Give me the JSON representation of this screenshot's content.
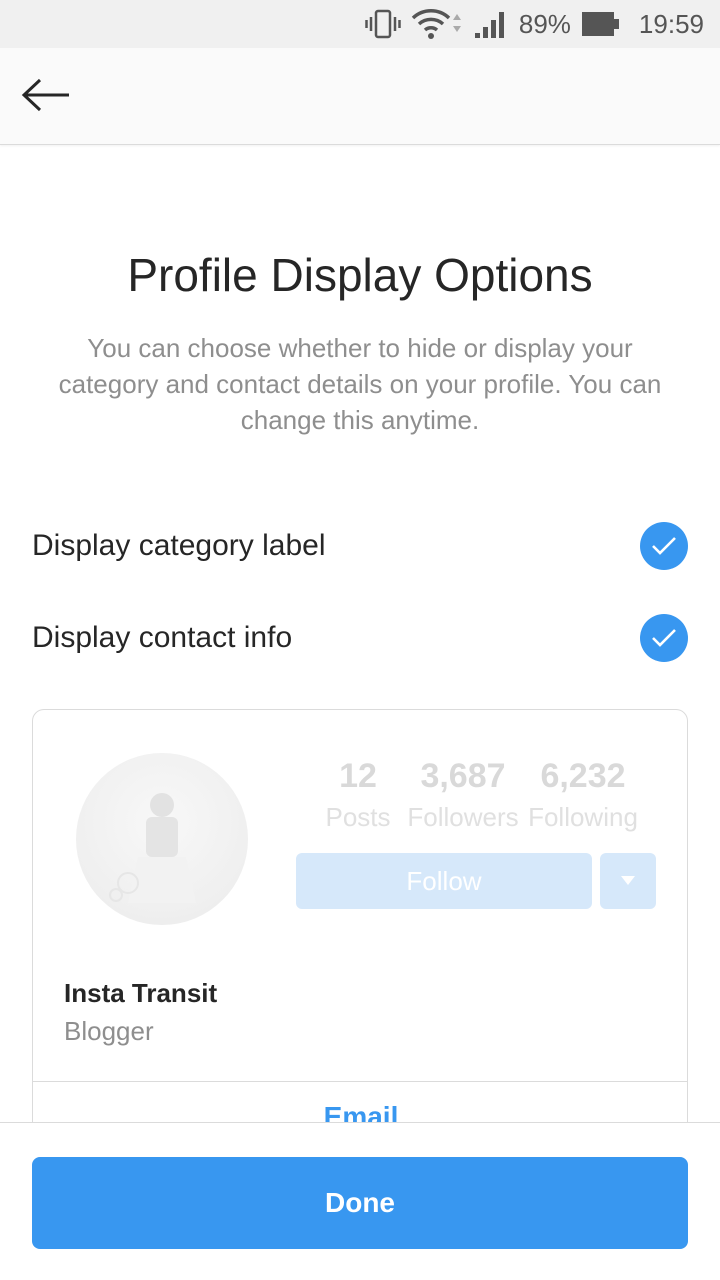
{
  "status_bar": {
    "battery": "89%",
    "time": "19:59",
    "icons": [
      "vibrate-icon",
      "wifi-icon",
      "signal-icon",
      "battery-icon"
    ]
  },
  "app_bar": {
    "back_icon": "arrow-left-icon"
  },
  "header": {
    "title": "Profile Display Options",
    "subtitle": "You can choose whether to hide or display your category and contact details on your profile. You can change this anytime."
  },
  "options": [
    {
      "label": "Display category label",
      "checked": true
    },
    {
      "label": "Display contact info",
      "checked": true
    }
  ],
  "preview": {
    "stats": [
      {
        "value": "12",
        "label": "Posts"
      },
      {
        "value": "3,687",
        "label": "Followers"
      },
      {
        "value": "6,232",
        "label": "Following"
      }
    ],
    "follow_label": "Follow",
    "name": "Insta Transit",
    "category": "Blogger",
    "contact_button": "Email"
  },
  "footer": {
    "done_label": "Done"
  },
  "colors": {
    "accent": "#3897f0",
    "accent_disabled": "#d6e8fa",
    "text_primary": "#262626",
    "text_secondary": "#8e8e8e"
  }
}
